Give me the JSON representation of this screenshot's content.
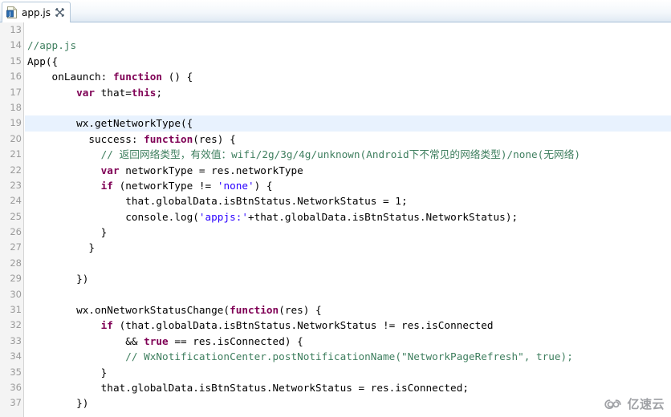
{
  "window": {
    "title": "app.js",
    "editor_type": "javascript-editor"
  },
  "tab": {
    "label": "app.js",
    "icon": "js-file-icon",
    "close_icon": "close-icon",
    "active": true
  },
  "editor": {
    "first_line_number": 13,
    "highlighted_line": 19,
    "colors": {
      "keyword": "#7f0055",
      "string": "#2a00ff",
      "comment": "#3f7f5f",
      "plain": "#000000",
      "gutter_bg": "#f4f4f4",
      "gutter_text": "#9b9b9b",
      "highlight_row": "#e8f2fe",
      "background": "#ffffff"
    },
    "lines": [
      {
        "n": 13,
        "tokens": []
      },
      {
        "n": 14,
        "tokens": [
          {
            "t": "com",
            "s": "//app.js"
          }
        ]
      },
      {
        "n": 15,
        "tokens": [
          {
            "t": "pln",
            "s": "App({"
          }
        ]
      },
      {
        "n": 16,
        "tokens": [
          {
            "t": "pln",
            "s": "    onLaunch: "
          },
          {
            "t": "kw",
            "s": "function"
          },
          {
            "t": "pln",
            "s": " () {"
          }
        ]
      },
      {
        "n": 17,
        "tokens": [
          {
            "t": "pln",
            "s": "        "
          },
          {
            "t": "kw",
            "s": "var"
          },
          {
            "t": "pln",
            "s": " that="
          },
          {
            "t": "kw",
            "s": "this"
          },
          {
            "t": "pln",
            "s": ";"
          }
        ]
      },
      {
        "n": 18,
        "tokens": []
      },
      {
        "n": 19,
        "tokens": [
          {
            "t": "pln",
            "s": "        wx.getNetworkType({"
          }
        ]
      },
      {
        "n": 20,
        "tokens": [
          {
            "t": "pln",
            "s": "          success: "
          },
          {
            "t": "kw",
            "s": "function"
          },
          {
            "t": "pln",
            "s": "(res) {"
          }
        ]
      },
      {
        "n": 21,
        "tokens": [
          {
            "t": "pln",
            "s": "            "
          },
          {
            "t": "com",
            "s": "// 返回网络类型，有效值：wifi/2g/3g/4g/unknown(Android下不常见的网络类型)/none(无网络)"
          }
        ]
      },
      {
        "n": 22,
        "tokens": [
          {
            "t": "pln",
            "s": "            "
          },
          {
            "t": "kw",
            "s": "var"
          },
          {
            "t": "pln",
            "s": " networkType = res.networkType"
          }
        ]
      },
      {
        "n": 23,
        "tokens": [
          {
            "t": "pln",
            "s": "            "
          },
          {
            "t": "kw",
            "s": "if"
          },
          {
            "t": "pln",
            "s": " (networkType != "
          },
          {
            "t": "str",
            "s": "'none'"
          },
          {
            "t": "pln",
            "s": ") {"
          }
        ]
      },
      {
        "n": 24,
        "tokens": [
          {
            "t": "pln",
            "s": "                that.globalData.isBtnStatus.NetworkStatus = 1;"
          }
        ]
      },
      {
        "n": 25,
        "tokens": [
          {
            "t": "pln",
            "s": "                console.log("
          },
          {
            "t": "str",
            "s": "'appjs:'"
          },
          {
            "t": "pln",
            "s": "+that.globalData.isBtnStatus.NetworkStatus);"
          }
        ]
      },
      {
        "n": 26,
        "tokens": [
          {
            "t": "pln",
            "s": "            }"
          }
        ]
      },
      {
        "n": 27,
        "tokens": [
          {
            "t": "pln",
            "s": "          }"
          }
        ]
      },
      {
        "n": 28,
        "tokens": []
      },
      {
        "n": 29,
        "tokens": [
          {
            "t": "pln",
            "s": "        })"
          }
        ]
      },
      {
        "n": 30,
        "tokens": []
      },
      {
        "n": 31,
        "tokens": [
          {
            "t": "pln",
            "s": "        wx.onNetworkStatusChange("
          },
          {
            "t": "kw",
            "s": "function"
          },
          {
            "t": "pln",
            "s": "(res) {"
          }
        ]
      },
      {
        "n": 32,
        "tokens": [
          {
            "t": "pln",
            "s": "            "
          },
          {
            "t": "kw",
            "s": "if"
          },
          {
            "t": "pln",
            "s": " (that.globalData.isBtnStatus.NetworkStatus != res.isConnected"
          }
        ]
      },
      {
        "n": 33,
        "tokens": [
          {
            "t": "pln",
            "s": "                && "
          },
          {
            "t": "kw",
            "s": "true"
          },
          {
            "t": "pln",
            "s": " == res.isConnected) {"
          }
        ]
      },
      {
        "n": 34,
        "tokens": [
          {
            "t": "pln",
            "s": "                "
          },
          {
            "t": "com",
            "s": "// WxNotificationCenter.postNotificationName(\"NetworkPageRefresh\", true);"
          }
        ]
      },
      {
        "n": 35,
        "tokens": [
          {
            "t": "pln",
            "s": "            }"
          }
        ]
      },
      {
        "n": 36,
        "tokens": [
          {
            "t": "pln",
            "s": "            that.globalData.isBtnStatus.NetworkStatus = res.isConnected;"
          }
        ]
      },
      {
        "n": 37,
        "tokens": [
          {
            "t": "pln",
            "s": "        })"
          }
        ]
      }
    ]
  },
  "watermark": {
    "text": "亿速云",
    "icon": "cloud-logo-icon"
  }
}
